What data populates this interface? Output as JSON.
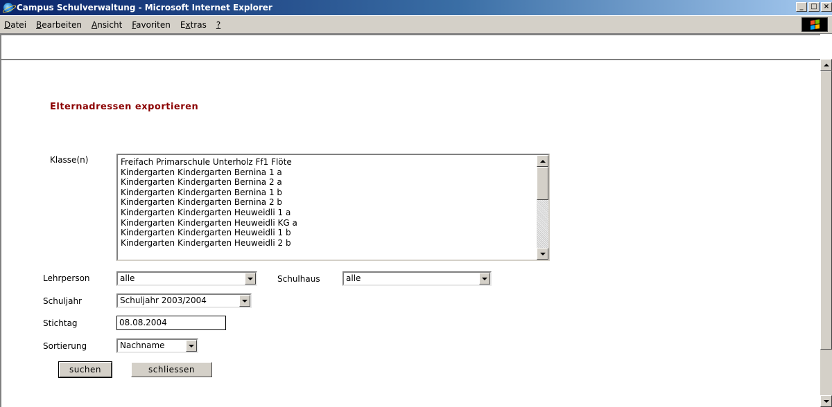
{
  "window": {
    "title": "Campus Schulverwaltung - Microsoft Internet Explorer",
    "buttons": {
      "minimize": "_",
      "maximize": "□",
      "close": "×"
    }
  },
  "menu": [
    {
      "label": "Datei",
      "accel": "D",
      "rest": "atei"
    },
    {
      "label": "Bearbeiten",
      "accel": "B",
      "rest": "earbeiten"
    },
    {
      "label": "Ansicht",
      "accel": "A",
      "rest": "nsicht"
    },
    {
      "label": "Favoriten",
      "accel": "F",
      "rest": "avoriten"
    },
    {
      "label": "Extras",
      "pre": "E",
      "accel": "x",
      "rest": "tras"
    },
    {
      "label": "?",
      "accel": "?",
      "rest": ""
    }
  ],
  "page": {
    "title": "Elternadressen exportieren",
    "klassen_label": "Klasse(n)",
    "klassen": [
      "Freifach Primarschule Unterholz Ff1 Flöte",
      "Kindergarten Kindergarten Bernina 1 a",
      "Kindergarten Kindergarten Bernina 2 a",
      "Kindergarten Kindergarten Bernina 1 b",
      "Kindergarten Kindergarten Bernina 2 b",
      "Kindergarten Kindergarten Heuweidli 1 a",
      "Kindergarten Kindergarten Heuweidli KG a",
      "Kindergarten Kindergarten Heuweidli 1 b",
      "Kindergarten Kindergarten Heuweidli 2 b"
    ],
    "lehrperson_label": "Lehrperson",
    "lehrperson_value": "alle",
    "schulhaus_label": "Schulhaus",
    "schulhaus_value": "alle",
    "schuljahr_label": "Schuljahr",
    "schuljahr_value": "Schuljahr 2003/2004",
    "stichtag_label": "Stichtag",
    "stichtag_value": "08.08.2004",
    "sortierung_label": "Sortierung",
    "sortierung_value": "Nachname",
    "suchen_label": "suchen",
    "schliessen_label": "schliessen"
  }
}
